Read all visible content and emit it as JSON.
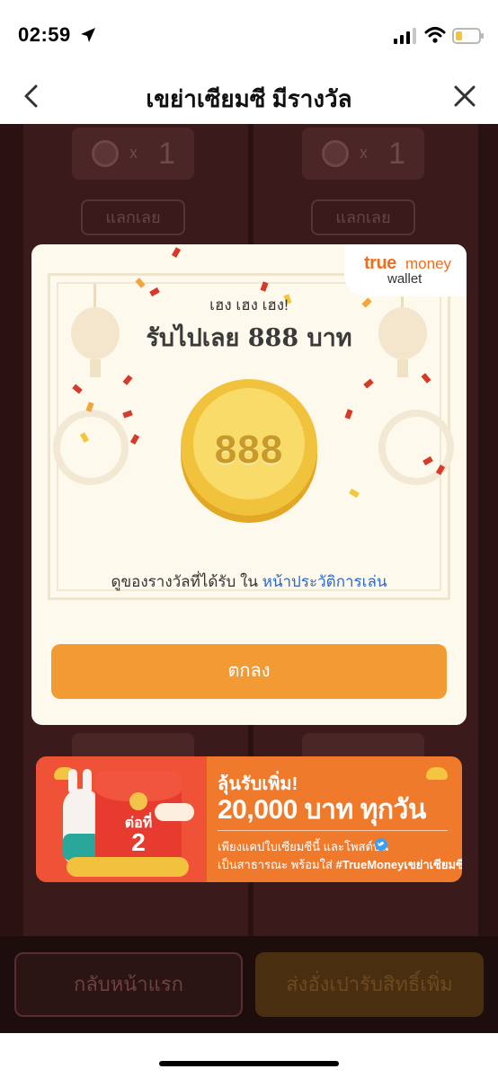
{
  "status_bar": {
    "time": "02:59"
  },
  "nav": {
    "title": "เขย่าเซียมซี มีรางวัล"
  },
  "background": {
    "token_multiplier": "x",
    "token_count": "1",
    "redeem_label": "แลกเลย",
    "home_button": "กลับหน้าแรก",
    "send_button": "ส่งอั่งเปารับสิทธิ์เพิ่ม"
  },
  "modal": {
    "brand_true": "true",
    "brand_money": "money",
    "brand_wallet": "wallet",
    "subtitle": "เฮง เฮง เฮง!",
    "title": "รับไปเลย 888 บาท",
    "coin_value": "888",
    "history_text": "ดูของรางวัลที่ได้รับ ใน",
    "history_link": "หน้าประวัติการเล่น",
    "ok_label": "ตกลง"
  },
  "banner": {
    "envelope_line1": "ต่อที่",
    "envelope_line2": "2",
    "headline": "ลุ้นรับเพิ่ม!",
    "amount": "20,000 บาท ทุกวัน",
    "line1": "เพียงแคปใบเซียมซีนี้ และโพสต์บน",
    "line2_prefix": "เป็นสาธารณะ พร้อมใส่",
    "hashtag": "#TrueMoneyเขย่าเซียมซี"
  },
  "colors": {
    "accent_orange": "#f29a34",
    "link_blue": "#2d67c7",
    "brand_orange": "#ef6d1b",
    "banner_orange": "#f07a2c",
    "coin_gold": "#f1c23c"
  },
  "icons": {
    "location": "location-arrow-icon",
    "signal": "cellular-signal-icon",
    "wifi": "wifi-icon",
    "battery": "battery-icon",
    "back": "chevron-left-icon",
    "close": "close-icon",
    "twitter": "twitter-icon"
  }
}
